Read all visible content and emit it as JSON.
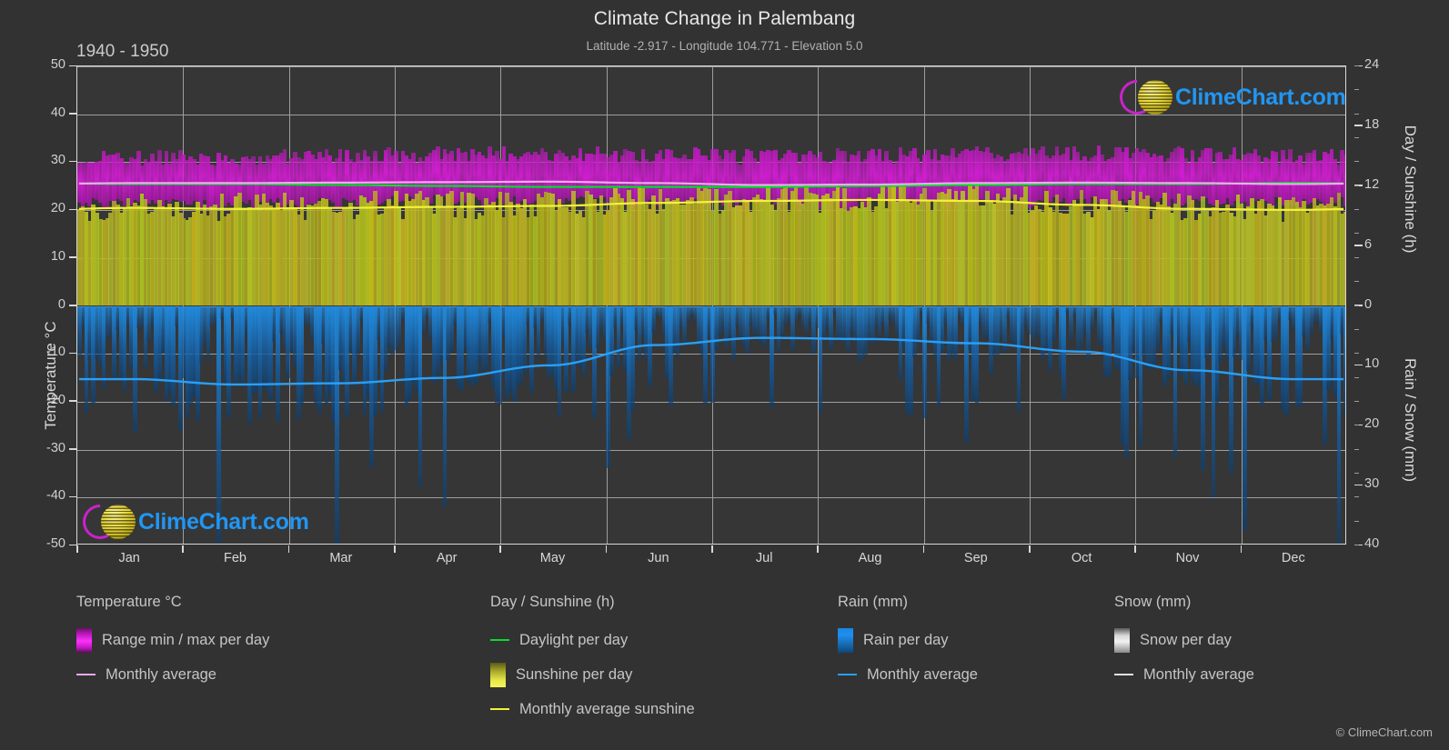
{
  "header": {
    "title": "Climate Change in Palembang",
    "subtitle": "Latitude -2.917 - Longitude 104.771 - Elevation 5.0",
    "period": "1940 - 1950"
  },
  "brand": {
    "name": "ClimeChart.com",
    "copyright": "© ClimeChart.com",
    "logo_icon": "climechart-logo-icon"
  },
  "legend": {
    "groups": [
      {
        "title": "Temperature °C",
        "items": [
          {
            "label": "Range min / max per day",
            "style": "swatch",
            "swatch": "sw-temp",
            "color": "#ff2fff"
          },
          {
            "label": "Monthly average",
            "style": "line",
            "color": "#f0a8f0"
          }
        ]
      },
      {
        "title": "Day / Sunshine (h)",
        "items": [
          {
            "label": "Daylight per day",
            "style": "line",
            "color": "#00e028"
          },
          {
            "label": "Sunshine per day",
            "style": "swatch",
            "swatch": "sw-sun",
            "color": "#e8e84a"
          },
          {
            "label": "Monthly average sunshine",
            "style": "line",
            "color": "#f2f23a"
          }
        ]
      },
      {
        "title": "Rain (mm)",
        "items": [
          {
            "label": "Rain per day",
            "style": "swatch",
            "swatch": "sw-rain",
            "color": "#1f8ff0"
          },
          {
            "label": "Monthly average",
            "style": "line",
            "color": "#2aa0f5"
          }
        ]
      },
      {
        "title": "Snow (mm)",
        "items": [
          {
            "label": "Snow per day",
            "style": "swatch",
            "swatch": "sw-snow",
            "color": "#e8e8e8"
          },
          {
            "label": "Monthly average",
            "style": "line",
            "color": "#e0e0e0"
          }
        ]
      }
    ]
  },
  "chart_data": {
    "type": "area",
    "title": "Climate Change in Palembang",
    "subtitle": "Latitude -2.917 - Longitude 104.771 - Elevation 5.0",
    "period": "1940 - 1950",
    "grid": true,
    "legend_position": "bottom",
    "xlabel": "",
    "x_tick_labels": [
      "Jan",
      "Feb",
      "Mar",
      "Apr",
      "May",
      "Jun",
      "Jul",
      "Aug",
      "Sep",
      "Oct",
      "Nov",
      "Dec"
    ],
    "axes": {
      "left": {
        "label": "Temperature °C",
        "ticks": [
          50,
          40,
          30,
          20,
          10,
          0,
          -10,
          -20,
          -30,
          -40,
          -50
        ],
        "range": [
          -50,
          50
        ]
      },
      "right_top": {
        "label": "Day / Sunshine (h)",
        "ticks": [
          24,
          18,
          12,
          6,
          0
        ],
        "range": [
          0,
          24
        ],
        "maps_to_temperature": [
          0,
          50
        ]
      },
      "right_bottom": {
        "label": "Rain / Snow (mm)",
        "ticks": [
          0,
          10,
          20,
          30,
          40
        ],
        "range": [
          0,
          40
        ],
        "maps_to_temperature": [
          0,
          -50
        ]
      }
    },
    "series": [
      {
        "name": "Monthly average temperature",
        "unit": "°C",
        "color": "#f0a8f0",
        "axis": "left",
        "values": [
          25.6,
          25.6,
          25.7,
          25.8,
          25.9,
          25.6,
          25.2,
          25.3,
          25.6,
          25.7,
          25.6,
          25.4
        ]
      },
      {
        "name": "Range max per day",
        "unit": "°C",
        "color": "#ff2fff",
        "axis": "left",
        "values": [
          30.8,
          30.9,
          31.2,
          31.5,
          31.6,
          31.4,
          31.0,
          31.2,
          31.6,
          31.7,
          31.4,
          31.0
        ]
      },
      {
        "name": "Range min per day",
        "unit": "°C",
        "color": "#ff2fff",
        "axis": "left",
        "values": [
          21.4,
          21.4,
          21.6,
          21.8,
          21.9,
          21.4,
          20.9,
          21.0,
          21.3,
          21.6,
          21.6,
          21.5
        ]
      },
      {
        "name": "Daylight per day",
        "unit": "h",
        "color": "#00e028",
        "axis": "right_top",
        "values": [
          12.2,
          12.2,
          12.1,
          12.0,
          11.9,
          11.9,
          11.9,
          12.0,
          12.1,
          12.2,
          12.2,
          12.3
        ]
      },
      {
        "name": "Monthly average sunshine",
        "unit": "h",
        "color": "#f2f23a",
        "axis": "right_top",
        "values": [
          9.8,
          9.7,
          9.8,
          9.9,
          10.0,
          10.3,
          10.5,
          10.6,
          10.5,
          10.1,
          9.7,
          9.6
        ]
      },
      {
        "name": "Rain monthly average",
        "unit": "mm",
        "color": "#2aa0f5",
        "axis": "right_bottom",
        "values": [
          12.3,
          13.2,
          13.0,
          12.1,
          10.0,
          6.6,
          5.4,
          5.6,
          6.3,
          7.7,
          10.8,
          12.3
        ]
      },
      {
        "name": "Snow monthly average",
        "unit": "mm",
        "color": "#e0e0e0",
        "axis": "right_bottom",
        "values": [
          0,
          0,
          0,
          0,
          0,
          0,
          0,
          0,
          0,
          0,
          0,
          0
        ]
      }
    ]
  }
}
